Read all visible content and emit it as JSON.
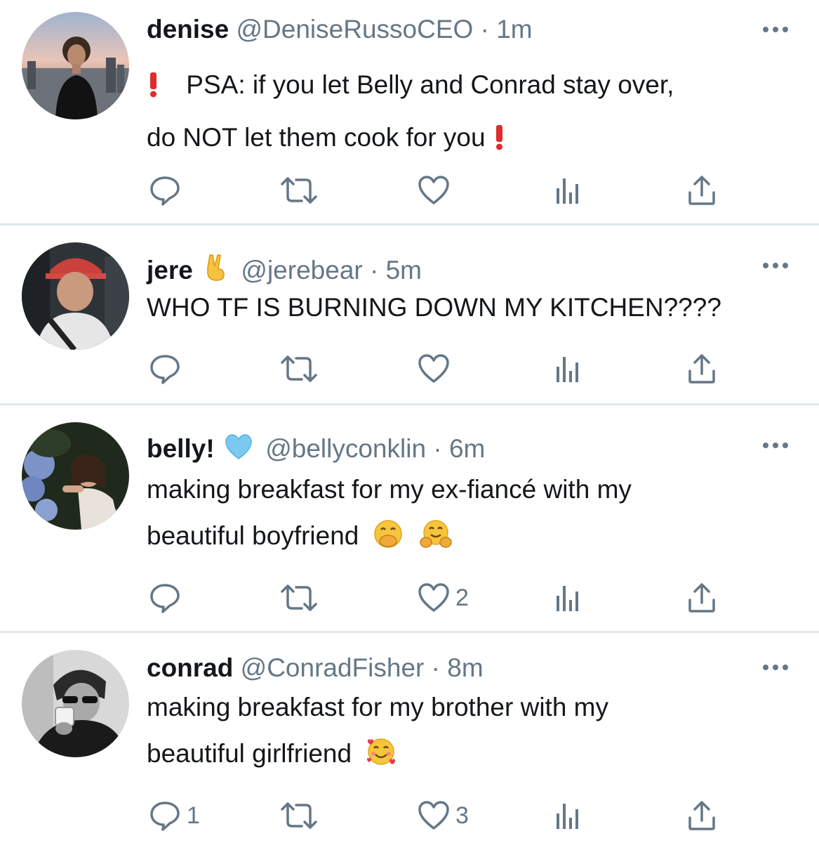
{
  "tweets": [
    {
      "name": "denise",
      "handle": "@DeniseRussoCEO",
      "separator": "·",
      "time": "1m",
      "lines": [
        "PSA: if you let Belly and Conrad stay over,",
        "do NOT let them cook for you"
      ],
      "prefix_emoji": "exclamation-icon",
      "suffix_emoji": "exclamation-icon",
      "replies": "",
      "likes": ""
    },
    {
      "name": "jere",
      "badge_emoji": "victory-hand-icon",
      "handle": "@jerebear",
      "separator": "·",
      "time": "5m",
      "lines": [
        "WHO TF IS BURNING DOWN MY KITCHEN????"
      ],
      "replies": "",
      "likes": ""
    },
    {
      "name": "belly!",
      "badge_emoji": "light-blue-heart-icon",
      "handle": "@bellyconklin",
      "separator": "·",
      "time": "6m",
      "lines": [
        "making breakfast for my ex-fiancé with my",
        "beautiful boyfriend"
      ],
      "suffix_emojis": [
        "face-with-hand-over-mouth-icon",
        "hugging-face-icon"
      ],
      "replies": "",
      "likes": "2"
    },
    {
      "name": "conrad",
      "handle": "@ConradFisher",
      "separator": "·",
      "time": "8m",
      "lines": [
        "making breakfast for my brother with my",
        "beautiful girlfriend"
      ],
      "suffix_emojis": [
        "smiling-face-with-hearts-icon"
      ],
      "replies": "1",
      "likes": "3"
    }
  ],
  "colors": {
    "text": "#14171a",
    "secondary": "#657786",
    "divider": "#e1e8ed",
    "exclamation": "#e02c2c"
  }
}
